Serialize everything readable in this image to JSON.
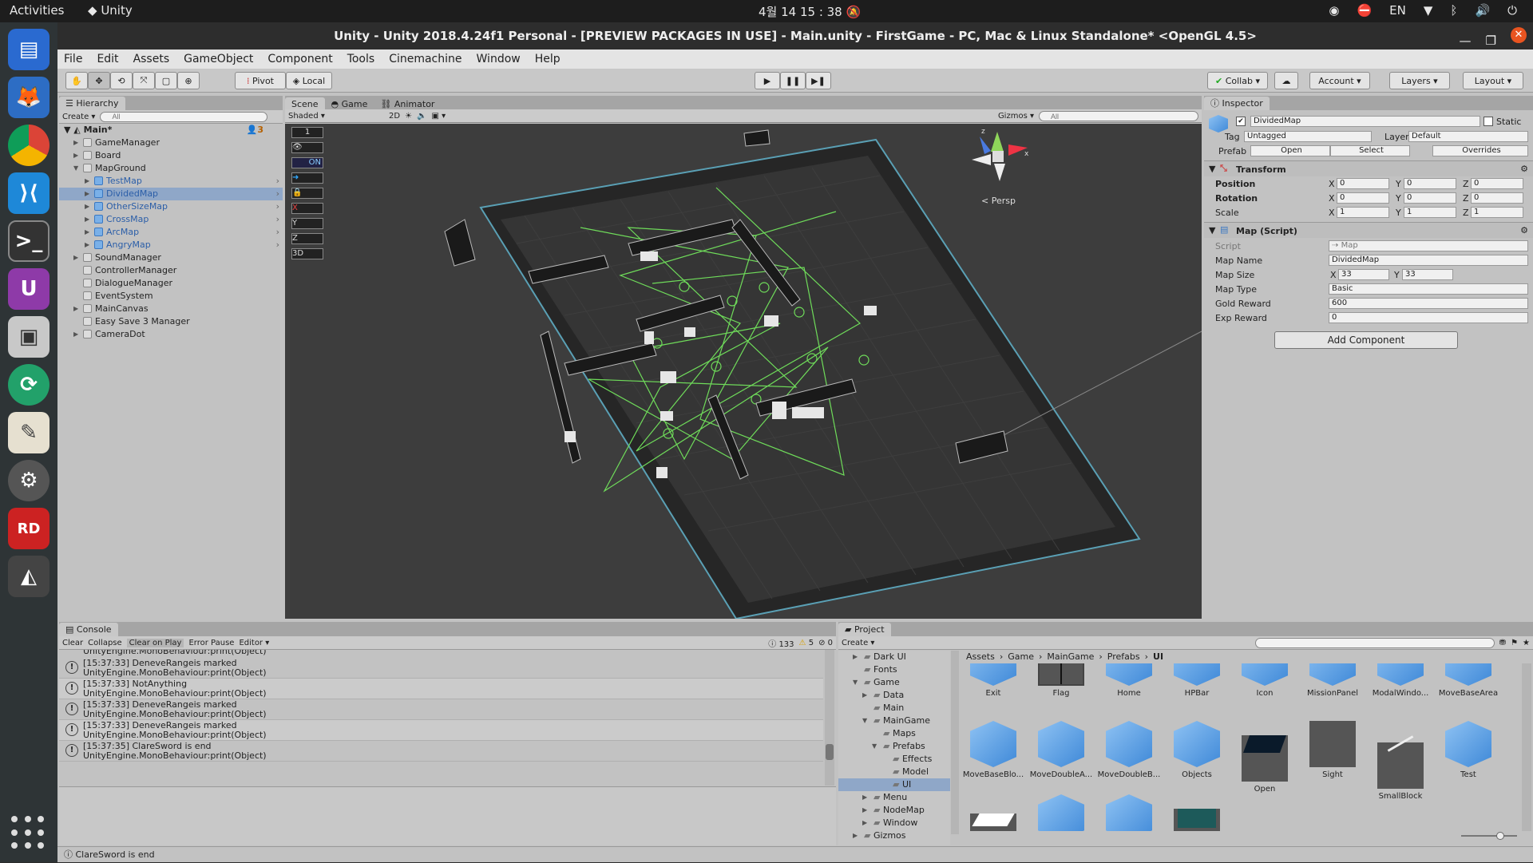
{
  "os": {
    "activities": "Activities",
    "app_name": "Unity",
    "clock": "4월 14  15 : 38",
    "lang": "EN"
  },
  "window": {
    "title": "Unity - Unity 2018.4.24f1 Personal - [PREVIEW PACKAGES IN USE] - Main.unity - FirstGame - PC, Mac & Linux Standalone* <OpenGL 4.5>"
  },
  "menu": [
    "File",
    "Edit",
    "Assets",
    "GameObject",
    "Component",
    "Tools",
    "Cinemachine",
    "Window",
    "Help"
  ],
  "toolbar": {
    "pivot": "Pivot",
    "local": "Local",
    "collab": "Collab",
    "account": "Account",
    "layers": "Layers",
    "layout": "Layout"
  },
  "hierarchy": {
    "tab": "Hierarchy",
    "create": "Create",
    "search": "All",
    "scene": "Main*",
    "badge": "3",
    "items": [
      {
        "label": "GameManager",
        "indent": 1,
        "arrow": true,
        "prefab": false,
        "sel": false
      },
      {
        "label": "Board",
        "indent": 1,
        "arrow": true,
        "prefab": false,
        "sel": false
      },
      {
        "label": "MapGround",
        "indent": 1,
        "arrow": true,
        "open": true,
        "prefab": false,
        "sel": false
      },
      {
        "label": "TestMap",
        "indent": 2,
        "arrow": true,
        "prefab": true,
        "sel": false
      },
      {
        "label": "DividedMap",
        "indent": 2,
        "arrow": true,
        "prefab": true,
        "sel": true
      },
      {
        "label": "OtherSizeMap",
        "indent": 2,
        "arrow": true,
        "prefab": true,
        "sel": false
      },
      {
        "label": "CrossMap",
        "indent": 2,
        "arrow": true,
        "prefab": true,
        "sel": false
      },
      {
        "label": "ArcMap",
        "indent": 2,
        "arrow": true,
        "prefab": true,
        "sel": false
      },
      {
        "label": "AngryMap",
        "indent": 2,
        "arrow": true,
        "prefab": true,
        "sel": false
      },
      {
        "label": "SoundManager",
        "indent": 1,
        "arrow": true,
        "prefab": false,
        "sel": false
      },
      {
        "label": "ControllerManager",
        "indent": 1,
        "arrow": false,
        "prefab": false,
        "sel": false
      },
      {
        "label": "DialogueManager",
        "indent": 1,
        "arrow": false,
        "prefab": false,
        "sel": false
      },
      {
        "label": "EventSystem",
        "indent": 1,
        "arrow": false,
        "prefab": false,
        "sel": false
      },
      {
        "label": "MainCanvas",
        "indent": 1,
        "arrow": true,
        "prefab": false,
        "sel": false
      },
      {
        "label": "Easy Save 3 Manager",
        "indent": 1,
        "arrow": false,
        "prefab": false,
        "sel": false
      },
      {
        "label": "CameraDot",
        "indent": 1,
        "arrow": true,
        "prefab": false,
        "sel": false
      }
    ]
  },
  "scene": {
    "tabs": [
      "Scene",
      "Game",
      "Animator"
    ],
    "shading": "Shaded",
    "mode2d": "2D",
    "gizmos": "Gizmos",
    "search": "All",
    "persp": "< Persp",
    "layer1": "1",
    "on": "ON",
    "x": "X",
    "y": "Y",
    "z": "Z",
    "threeD": "3D"
  },
  "inspector": {
    "tab": "Inspector",
    "name": "DividedMap",
    "static": "Static",
    "tag_label": "Tag",
    "tag": "Untagged",
    "layer_label": "Layer",
    "layer": "Default",
    "prefab_label": "Prefab",
    "open": "Open",
    "select": "Select",
    "overrides": "Overrides",
    "transform": "Transform",
    "position": "Position",
    "rotation": "Rotation",
    "scale": "Scale",
    "pos": [
      "0",
      "0",
      "0"
    ],
    "rot": [
      "0",
      "0",
      "0"
    ],
    "scl": [
      "1",
      "1",
      "1"
    ],
    "map_script": "Map (Script)",
    "script_label": "Script",
    "script_val": "Map",
    "map_name_label": "Map Name",
    "map_name": "DividedMap",
    "map_size_label": "Map Size",
    "map_size_x": "33",
    "map_size_y": "33",
    "map_type_label": "Map Type",
    "map_type": "Basic",
    "gold_label": "Gold Reward",
    "gold": "600",
    "exp_label": "Exp Reward",
    "exp": "0",
    "add_component": "Add Component"
  },
  "console": {
    "tab": "Console",
    "clear": "Clear",
    "collapse": "Collapse",
    "clear_on_play": "Clear on Play",
    "error_pause": "Error Pause",
    "editor": "Editor",
    "count_log": "133",
    "count_warn": "5",
    "count_err": "0",
    "partial": "UnityEngine.MonoBehaviour:print(Object)",
    "rows": [
      {
        "l1": "[15:37:33] DeneveRangeis marked",
        "l2": "UnityEngine.MonoBehaviour:print(Object)"
      },
      {
        "l1": "[15:37:33] NotAnything",
        "l2": "UnityEngine.MonoBehaviour:print(Object)"
      },
      {
        "l1": "[15:37:33] DeneveRangeis marked",
        "l2": "UnityEngine.MonoBehaviour:print(Object)"
      },
      {
        "l1": "[15:37:33] DeneveRangeis marked",
        "l2": "UnityEngine.MonoBehaviour:print(Object)"
      },
      {
        "l1": "[15:37:35] ClareSword is end",
        "l2": "UnityEngine.MonoBehaviour:print(Object)"
      }
    ],
    "status": "ClareSword is end"
  },
  "project": {
    "tab": "Project",
    "create": "Create",
    "breadcrumb": [
      "Assets",
      "Game",
      "MainGame",
      "Prefabs",
      "UI"
    ],
    "tree": [
      {
        "label": "Dark UI",
        "indent": 1,
        "arrow": "closed"
      },
      {
        "label": "Fonts",
        "indent": 1,
        "arrow": "none"
      },
      {
        "label": "Game",
        "indent": 1,
        "arrow": "open"
      },
      {
        "label": "Data",
        "indent": 2,
        "arrow": "closed"
      },
      {
        "label": "Main",
        "indent": 2,
        "arrow": "none"
      },
      {
        "label": "MainGame",
        "indent": 2,
        "arrow": "open"
      },
      {
        "label": "Maps",
        "indent": 3,
        "arrow": "none"
      },
      {
        "label": "Prefabs",
        "indent": 3,
        "arrow": "open"
      },
      {
        "label": "Effects",
        "indent": 4,
        "arrow": "none"
      },
      {
        "label": "Model",
        "indent": 4,
        "arrow": "none"
      },
      {
        "label": "UI",
        "indent": 4,
        "arrow": "none",
        "sel": true
      },
      {
        "label": "Menu",
        "indent": 2,
        "arrow": "closed"
      },
      {
        "label": "NodeMap",
        "indent": 2,
        "arrow": "closed"
      },
      {
        "label": "Window",
        "indent": 2,
        "arrow": "closed"
      },
      {
        "label": "Gizmos",
        "indent": 1,
        "arrow": "closed"
      }
    ],
    "assets_row1": [
      "Exit",
      "Flag",
      "Home",
      "HPBar",
      "Icon",
      "MissionPanel",
      "ModalWindo...",
      "MoveBaseArea"
    ],
    "assets_row2": [
      "MoveBaseBlo...",
      "MoveDoubleA...",
      "MoveDoubleB...",
      "Objects",
      "Open",
      "Sight",
      "SmallBlock",
      "Test"
    ]
  }
}
